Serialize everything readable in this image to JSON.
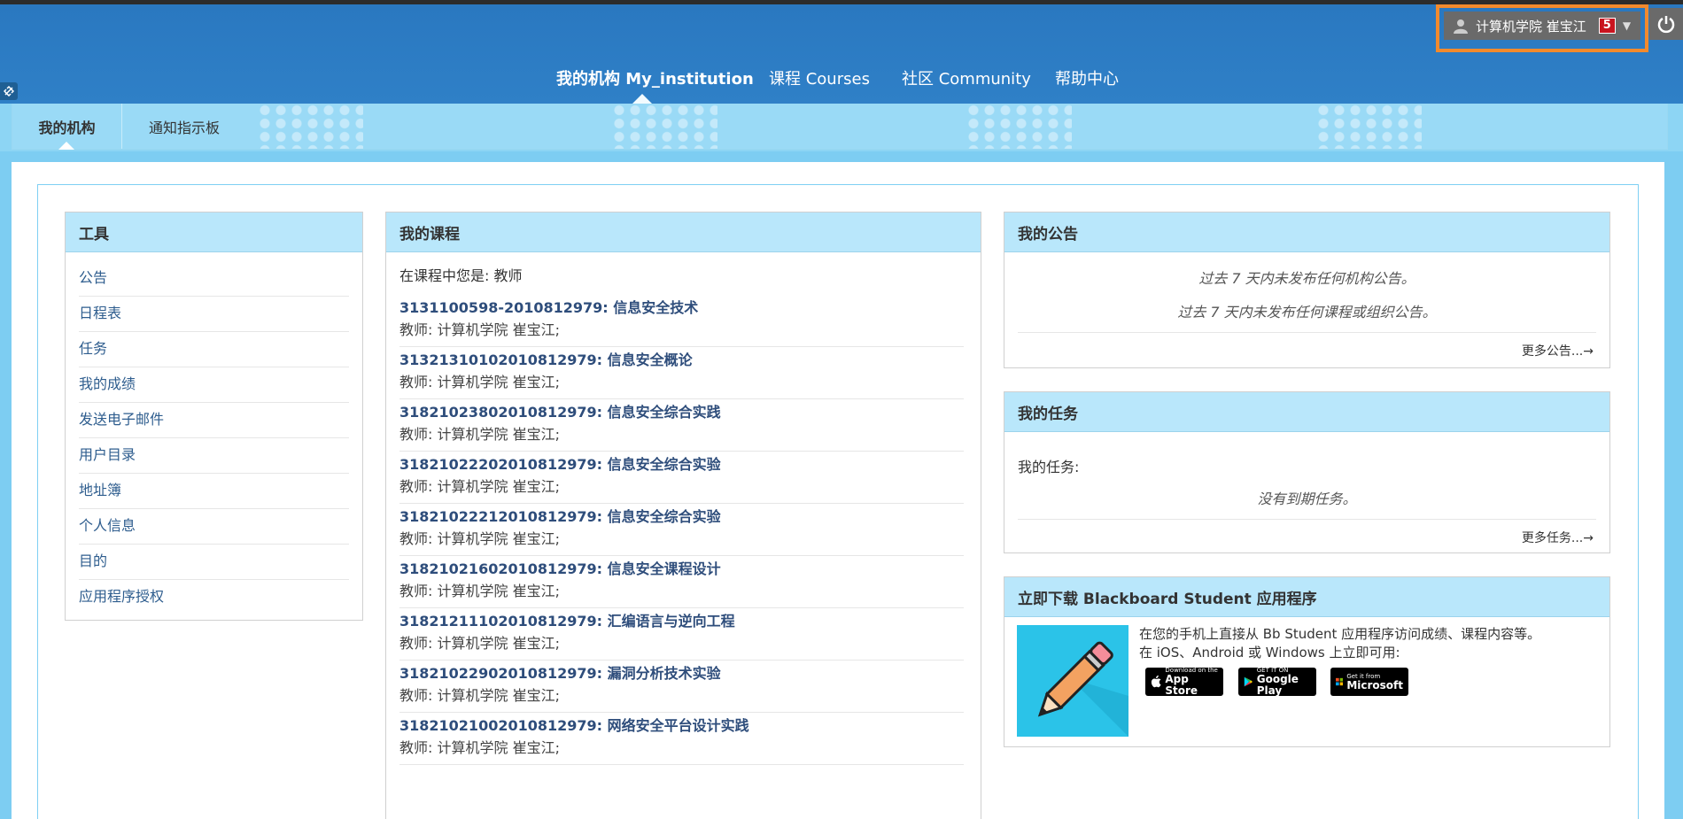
{
  "topbar": {
    "user_name": "计算机学院 崔宝江",
    "notification_count": "5"
  },
  "nav": {
    "items": [
      {
        "label": "我的机构 My_institution",
        "active": true
      },
      {
        "label": "课程 Courses"
      },
      {
        "label": "社区 Community"
      },
      {
        "label": "帮助中心"
      }
    ]
  },
  "subnav": {
    "tabs": [
      {
        "label": "我的机构",
        "active": true
      },
      {
        "label": "通知指示板"
      }
    ]
  },
  "tools": {
    "title": "工具",
    "items": [
      "公告",
      "日程表",
      "任务",
      "我的成绩",
      "发送电子邮件",
      "用户目录",
      "地址簿",
      "个人信息",
      "目的",
      "应用程序授权"
    ]
  },
  "courses": {
    "title": "我的课程",
    "role_line": "在课程中您是: 教师",
    "items": [
      {
        "title": "3131100598-2010812979: 信息安全技术",
        "instructor": "教师: 计算机学院 崔宝江;"
      },
      {
        "title": "31321310102010812979: 信息安全概论",
        "instructor": "教师: 计算机学院 崔宝江;"
      },
      {
        "title": "31821023802010812979: 信息安全综合实践",
        "instructor": "教师: 计算机学院 崔宝江;"
      },
      {
        "title": "31821022202010812979: 信息安全综合实验",
        "instructor": "教师: 计算机学院 崔宝江;"
      },
      {
        "title": "31821022212010812979: 信息安全综合实验",
        "instructor": "教师: 计算机学院 崔宝江;"
      },
      {
        "title": "31821021602010812979: 信息安全课程设计",
        "instructor": "教师: 计算机学院 崔宝江;"
      },
      {
        "title": "31821211102010812979: 汇编语言与逆向工程",
        "instructor": "教师: 计算机学院 崔宝江;"
      },
      {
        "title": "31821022902010812979: 漏洞分析技术实验",
        "instructor": "教师: 计算机学院 崔宝江;"
      },
      {
        "title": "31821021002010812979: 网络安全平台设计实践",
        "instructor": "教师: 计算机学院 崔宝江;"
      }
    ]
  },
  "announcements": {
    "title": "我的公告",
    "line1": "过去 7 天内未发布任何机构公告。",
    "line2": "过去 7 天内未发布任何课程或组织公告。",
    "more": "更多公告...→"
  },
  "tasks": {
    "title": "我的任务",
    "label": "我的任务:",
    "empty": "没有到期任务。",
    "more": "更多任务...→"
  },
  "app_promo": {
    "title": "立即下载 Blackboard Student 应用程序",
    "line1": "在您的手机上直接从 Bb Student 应用程序访问成绩、课程内容等。",
    "line2": "在 iOS、Android 或 Windows 上立即可用:",
    "stores": [
      {
        "small": "Download on the",
        "big": "App Store"
      },
      {
        "small": "GET IT ON",
        "big": "Google Play"
      },
      {
        "small": "Get it from",
        "big": "Microsoft"
      }
    ]
  },
  "colors": {
    "header_blue": "#2f80c7",
    "subbar_blue": "#8dd5f4",
    "module_head": "#b9e7fb",
    "highlight_orange": "#f28a2d",
    "badge_red": "#c9141f"
  }
}
